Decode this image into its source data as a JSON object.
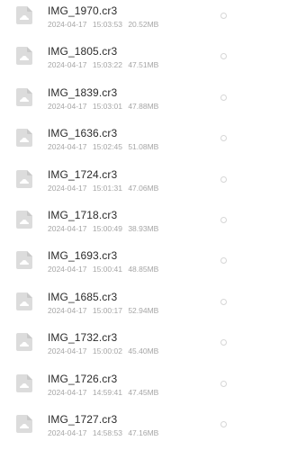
{
  "files": [
    {
      "name": "IMG_1970.cr3",
      "date": "2024-04-17",
      "time": "15:03:53",
      "size": "20.52MB",
      "icon": "image-file-icon"
    },
    {
      "name": "IMG_1805.cr3",
      "date": "2024-04-17",
      "time": "15:03:22",
      "size": "47.51MB",
      "icon": "image-file-icon"
    },
    {
      "name": "IMG_1839.cr3",
      "date": "2024-04-17",
      "time": "15:03:01",
      "size": "47.88MB",
      "icon": "image-file-icon"
    },
    {
      "name": "IMG_1636.cr3",
      "date": "2024-04-17",
      "time": "15:02:45",
      "size": "51.08MB",
      "icon": "image-file-icon"
    },
    {
      "name": "IMG_1724.cr3",
      "date": "2024-04-17",
      "time": "15:01:31",
      "size": "47.06MB",
      "icon": "image-file-icon"
    },
    {
      "name": "IMG_1718.cr3",
      "date": "2024-04-17",
      "time": "15:00:49",
      "size": "38.93MB",
      "icon": "image-file-icon"
    },
    {
      "name": "IMG_1693.cr3",
      "date": "2024-04-17",
      "time": "15:00:41",
      "size": "48.85MB",
      "icon": "image-file-icon"
    },
    {
      "name": "IMG_1685.cr3",
      "date": "2024-04-17",
      "time": "15:00:17",
      "size": "52.94MB",
      "icon": "image-file-icon"
    },
    {
      "name": "IMG_1732.cr3",
      "date": "2024-04-17",
      "time": "15:00:02",
      "size": "45.40MB",
      "icon": "image-file-icon"
    },
    {
      "name": "IMG_1726.cr3",
      "date": "2024-04-17",
      "time": "14:59:41",
      "size": "47.45MB",
      "icon": "image-file-icon"
    },
    {
      "name": "IMG_1727.cr3",
      "date": "2024-04-17",
      "time": "14:58:53",
      "size": "47.16MB",
      "icon": "image-file-icon"
    }
  ],
  "colors": {
    "icon_fill": "#dcdcdc",
    "icon_glyph": "#ffffff",
    "name_text": "#2b2b2b",
    "meta_text": "#a6a6a6",
    "circle_border": "#d6d6d6"
  }
}
